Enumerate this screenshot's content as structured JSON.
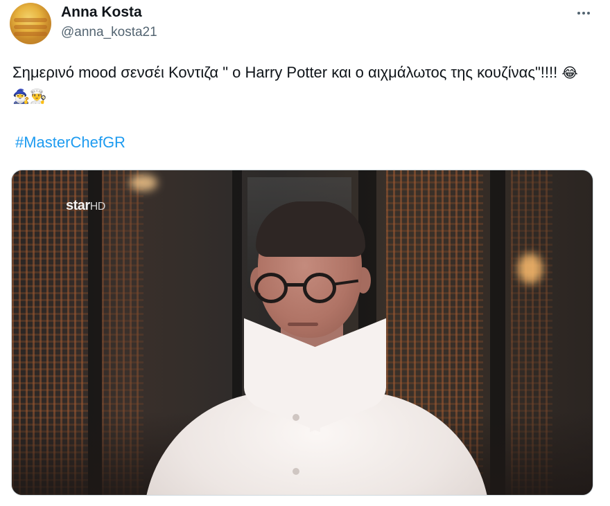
{
  "tweet": {
    "author": {
      "name": "Anna Kosta",
      "handle": "@anna_kosta21",
      "avatar_icon": "avatar-image"
    },
    "more_icon": "more-horizontal-icon",
    "text": "Σημερινό mood σενσέι Κοντιζα \" ο Harry Potter και ο αιχμάλωτος της κουζίνας\"!!!!",
    "emojis": "😂🧙‍♂️👨‍🍳",
    "hashtag": "#MasterChefGR",
    "media": {
      "logo_main": "star",
      "logo_suffix": "HD"
    }
  },
  "colors": {
    "text": "#0f1419",
    "secondary": "#536471",
    "link": "#1d9bf0"
  }
}
